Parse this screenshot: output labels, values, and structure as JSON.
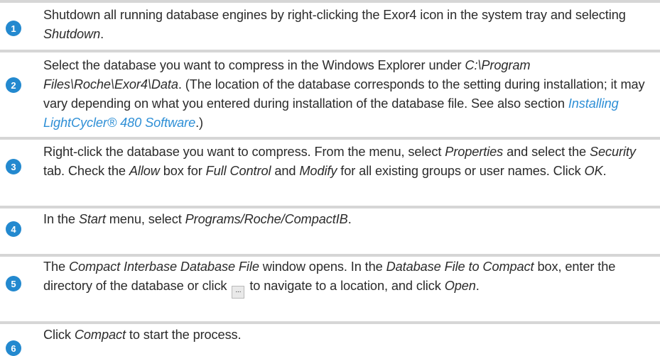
{
  "steps": [
    {
      "number": "1",
      "t1": "Shutdown all running database engines by right-clicking the Exor4 icon in the system tray and selecting ",
      "i1": "Shutdown",
      "t2": "."
    },
    {
      "number": "2",
      "t1": "Select the database you want to compress in the Windows Explorer under ",
      "i1": "C:\\Program Files\\Roche\\Exor4\\Data",
      "t2": ". (The location of the database corresponds to the setting during installation; it may vary depending on what you entered during installation of the database file. See also section ",
      "link": "Installing LightCycler® 480 Software",
      "t3": ".)"
    },
    {
      "number": "3",
      "t1": "Right-click the database you want to compress. From the menu, select ",
      "i1": "Properties",
      "t2": " and select the ",
      "i2": "Security",
      "t3": " tab. Check the ",
      "i3": "Allow",
      "t4": " box for ",
      "i4": "Full Control",
      "t5": " and ",
      "i5": "Modify",
      "t6": " for all existing groups or user names. Click ",
      "i6": "OK",
      "t7": "."
    },
    {
      "number": "4",
      "t1": "In the ",
      "i1": "Start",
      "t2": " menu, select ",
      "i2": "Programs/Roche/CompactIB",
      "t3": "."
    },
    {
      "number": "5",
      "t1": "The ",
      "i1": "Compact Interbase Database File",
      "t2": " window opens. In the ",
      "i2": "Database File to Compact",
      "t3": " box, enter the directory of the database or click ",
      "button": "...",
      "t4": " to navigate to a location, and click ",
      "i3": "Open",
      "t5": "."
    },
    {
      "number": "6",
      "t1": "Click ",
      "i1": "Compact",
      "t2": " to start the process."
    }
  ]
}
